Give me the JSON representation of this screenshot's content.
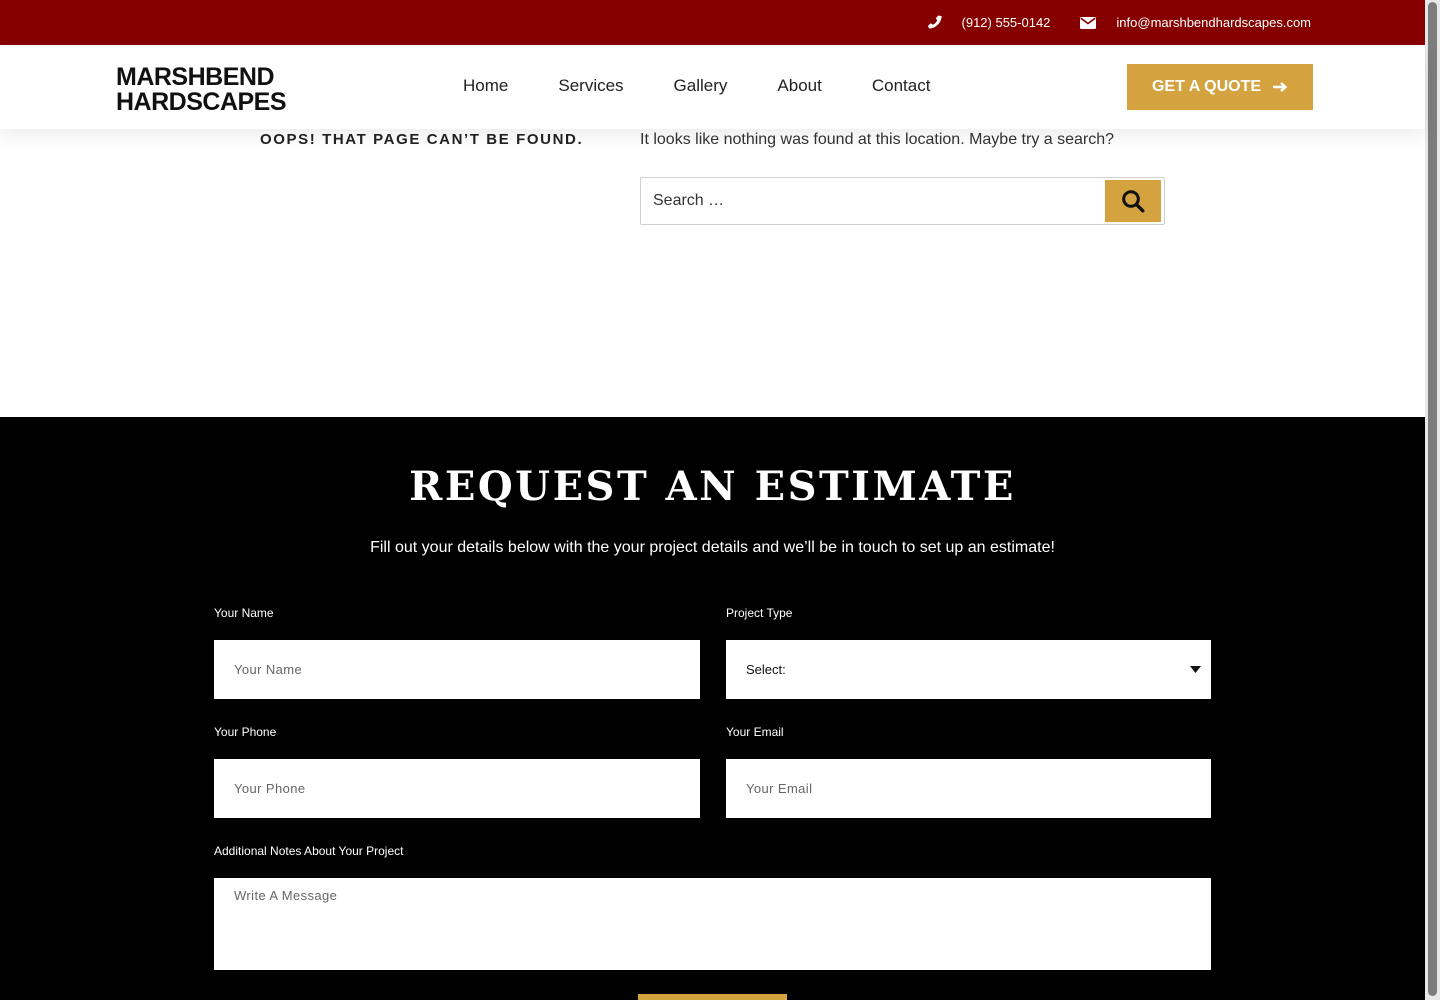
{
  "topbar": {
    "phone": "(912) 555-0142",
    "email": "info@marshbendhardscapes.com"
  },
  "header": {
    "logo_line1": "MARSHBEND",
    "logo_line2": "HARDSCAPES",
    "nav": [
      "Home",
      "Services",
      "Gallery",
      "About",
      "Contact"
    ],
    "cta_label": "GET A QUOTE"
  },
  "notfound": {
    "title": "OOPS! THAT PAGE CAN’T BE FOUND.",
    "message": "It looks like nothing was found at this location. Maybe try a search?",
    "search_placeholder": "Search …"
  },
  "estimate": {
    "heading": "REQUEST AN ESTIMATE",
    "subheading": "Fill out your details below with the your project details and we’ll be in touch to set up an estimate!",
    "name_label": "Your Name",
    "name_placeholder": "Your Name",
    "project_label": "Project Type",
    "project_value": "Select:",
    "phone_label": "Your Phone",
    "phone_placeholder": "Your Phone",
    "email_label": "Your Email",
    "email_placeholder": "Your Email",
    "notes_label": "Additional Notes About Your Project",
    "notes_placeholder": "Write A Message"
  },
  "colors": {
    "topbar": "#870000",
    "accent": "#d4a33f",
    "section_bg": "#000000"
  },
  "icons": {
    "phone": "phone-icon",
    "email": "envelope-icon",
    "arrow": "arrow-right-icon",
    "search": "search-icon",
    "caret": "caret-down-icon"
  }
}
